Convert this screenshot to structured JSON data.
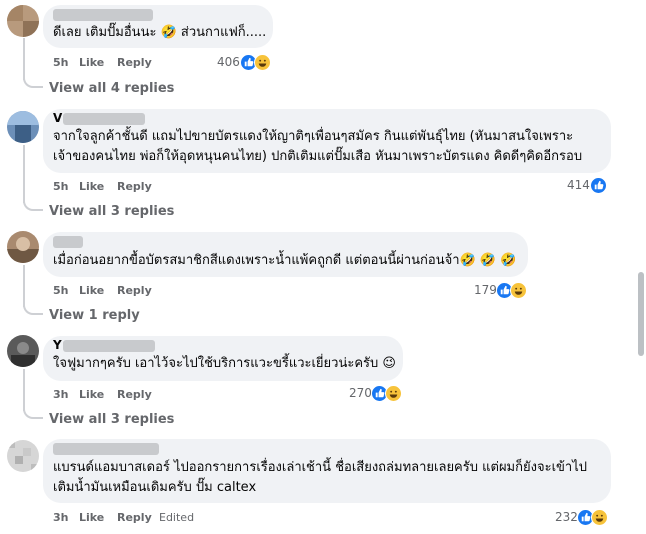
{
  "comments": [
    {
      "text_lines": [
        "ดีเลย เติมปั๊มอื่นนะ 🤣 ส่วนกาแฟก็....."
      ],
      "time": "5h",
      "like": "Like",
      "reply": "Reply",
      "edited": "",
      "reaction_count": "406",
      "reactions": [
        "like-icon",
        "haha-icon"
      ],
      "view_replies": "View all 4 replies",
      "name_prefix": ""
    },
    {
      "text_lines": [
        "จากใจลูกค้าชั้นดี แถมไปขายบัตรแดงให้ญาติๆเพื่อนๆสมัคร กินแต่พันธุ์ไทย (หันมาสนใจเพราะ",
        "เจ้าของคนไทย พ่อก็ให้อุดหนุนคนไทย) ปกติเติมแต่ปั๊มเสือ หันมาเพราะบัตรแดง คิดดีๆคิดอีกรอบ"
      ],
      "time": "5h",
      "like": "Like",
      "reply": "Reply",
      "edited": "",
      "reaction_count": "414",
      "reactions": [
        "like-icon"
      ],
      "view_replies": "View all 3 replies",
      "name_prefix": "V"
    },
    {
      "text_lines": [
        "เมื่อก่อนอยากขื้อบัตรสมาชิกสีแดงเพราะน้ำแพ้คถูกดี แต่ตอนนี้ผ่านก่อนจ้า🤣 🤣 🤣"
      ],
      "time": "5h",
      "like": "Like",
      "reply": "Reply",
      "edited": "",
      "reaction_count": "179",
      "reactions": [
        "like-icon",
        "haha-icon"
      ],
      "view_replies": "View 1 reply",
      "name_prefix": ""
    },
    {
      "text_lines": [
        "ใจฟูมากๆครับ เอาไว้จะไปใช้บริการแวะขรี้แวะเยี่ยวน่ะครับ 😉"
      ],
      "time": "3h",
      "like": "Like",
      "reply": "Reply",
      "edited": "",
      "reaction_count": "270",
      "reactions": [
        "like-icon",
        "haha-icon"
      ],
      "view_replies": "View all 3 replies",
      "name_prefix": "Y"
    },
    {
      "text_lines": [
        "แบรนด์แอมบาสเดอร์ ไปออกรายการเรื่องเล่าเช้านี้ ชื่อเสียงถล่มทลายเลยครับ แต่ผมก็ยังจะเข้าไป",
        "เติมน้ำมันเหมือนเดิมครับ ปั๊ม caltex"
      ],
      "time": "3h",
      "like": "Like",
      "reply": "Reply",
      "edited": "Edited",
      "reaction_count": "232",
      "reactions": [
        "like-icon",
        "haha-icon"
      ],
      "view_replies": "",
      "name_prefix": ""
    }
  ],
  "colors": {
    "bubble": "#f0f2f5",
    "like": "#1877f2",
    "haha": "#f7c33b",
    "meta": "#65676b"
  }
}
